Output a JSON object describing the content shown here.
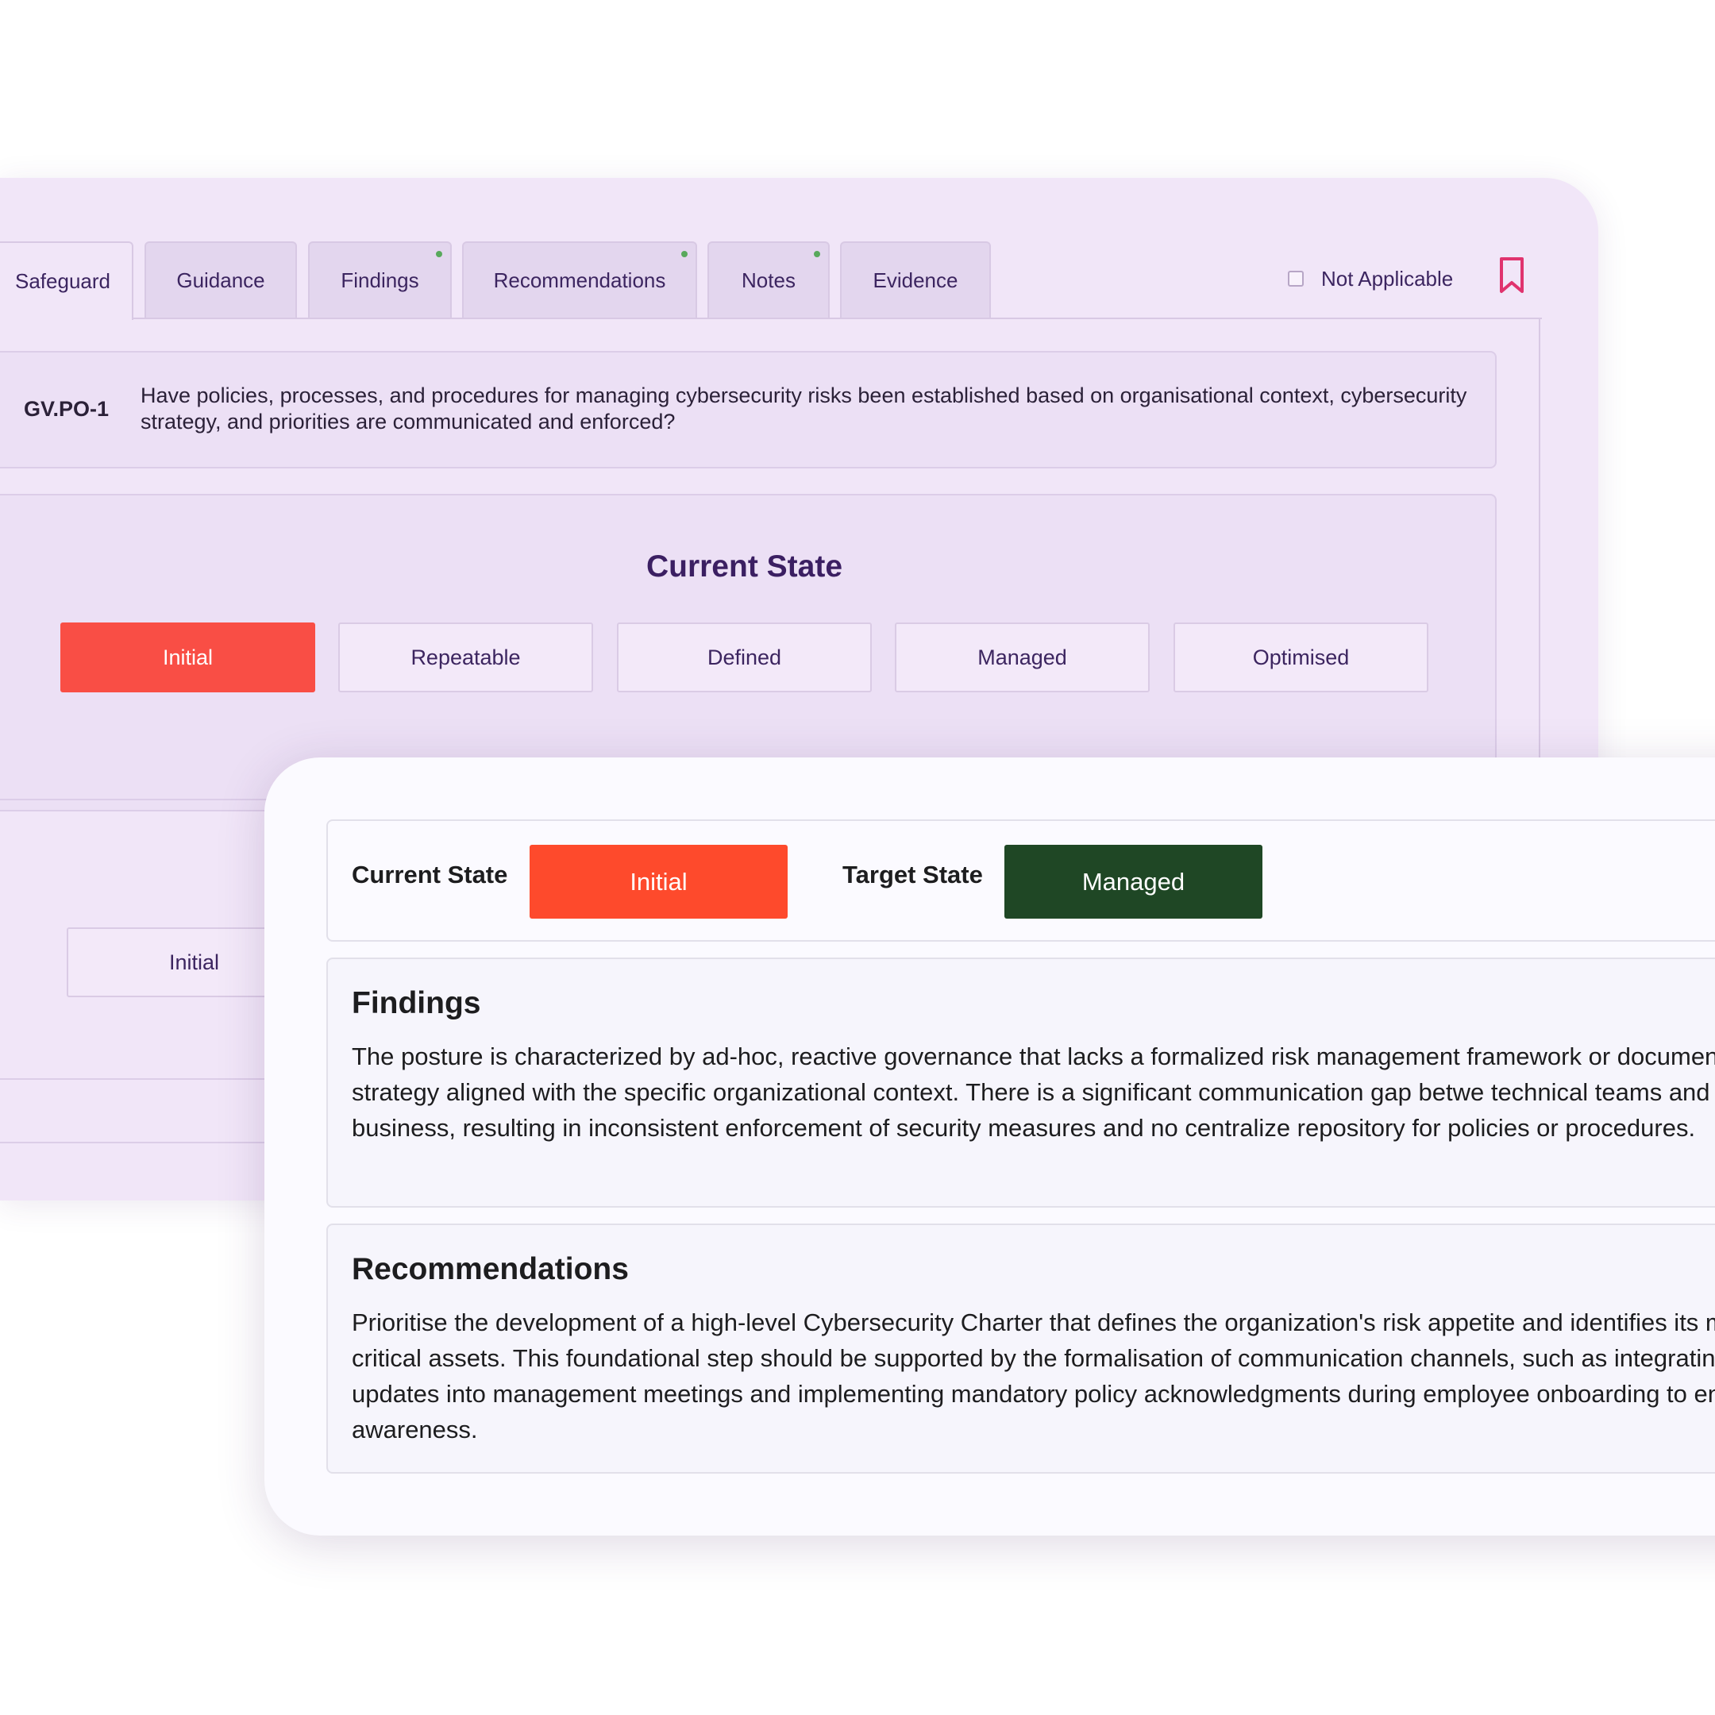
{
  "tabs": [
    {
      "label": "Safeguard",
      "has_dot": false
    },
    {
      "label": "Guidance",
      "has_dot": false
    },
    {
      "label": "Findings",
      "has_dot": true
    },
    {
      "label": "Recommendations",
      "has_dot": true
    },
    {
      "label": "Notes",
      "has_dot": true
    },
    {
      "label": "Evidence",
      "has_dot": false
    }
  ],
  "not_applicable": {
    "label": "Not Applicable",
    "checked": false
  },
  "question": {
    "code": "GV.PO-1",
    "text": "Have policies, processes, and procedures for managing cybersecurity risks been established based on organisational context, cybersecurity strategy, and priorities are communicated and enforced?"
  },
  "current_state_section": {
    "title": "Current State",
    "levels": [
      "Initial",
      "Repeatable",
      "Defined",
      "Managed",
      "Optimised"
    ],
    "selected": "Initial"
  },
  "second_section": {
    "visible_level": "Initial"
  },
  "summary": {
    "current_label": "Current State",
    "current_value": "Initial",
    "target_label": "Target State",
    "target_value": "Managed"
  },
  "findings": {
    "title": "Findings",
    "text": "The posture is characterized by ad-hoc, reactive governance that lacks a formalized risk management framework or documented strategy aligned with the specific organizational context. There is a significant communication gap betwe technical teams and the wider business, resulting in inconsistent enforcement of security measures and no centralize repository for policies or procedures."
  },
  "recommendations": {
    "title": "Recommendations",
    "text": "Prioritise the development of a high-level Cybersecurity Charter that defines the organization's risk appetite and identifies its most critical assets. This foundational step should be supported by the formalisation of communication channels, such as integrating security updates into management meetings and implementing mandatory policy acknowledgments during employee onboarding to ensure awareness."
  },
  "colors": {
    "back_panel": "#f1e6f8",
    "current_initial": "#f94e45",
    "summary_current": "#fe4a2c",
    "summary_target": "#1f4725",
    "bookmark": "#e0336e",
    "tab_dot": "#58a95c"
  },
  "icons": {
    "bookmark": "bookmark-icon",
    "checkbox": "checkbox-icon"
  }
}
